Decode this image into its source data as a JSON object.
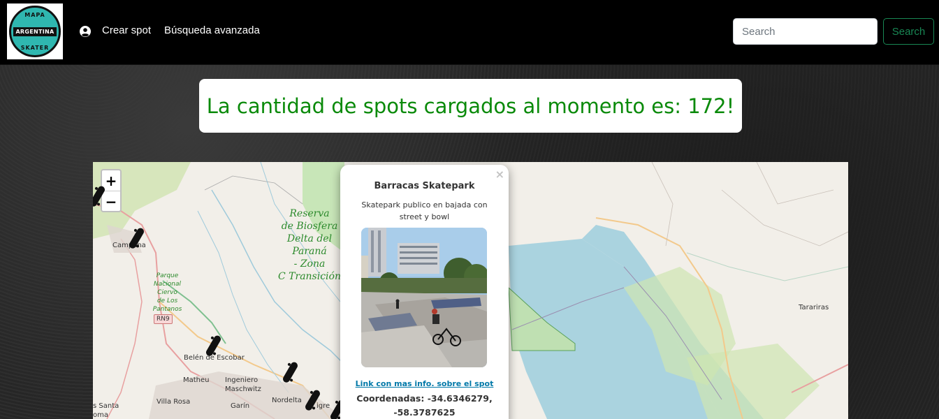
{
  "navbar": {
    "logo": {
      "top_text": "MAPA",
      "band_text": "ARGENTINA",
      "bottom_text": "SKATER"
    },
    "user_icon": "user-circle-icon",
    "links": [
      "Crear spot",
      "Búsqueda avanzada"
    ],
    "search": {
      "placeholder": "Search",
      "button_label": "Search",
      "button_color": "#198754"
    }
  },
  "banner": {
    "text": "La cantidad de spots cargados al momento es: 172!",
    "color": "#0a8a0a"
  },
  "map": {
    "zoom_in": "+",
    "zoom_out": "−",
    "reserve_lines": [
      "Reserva",
      "de Biosfera",
      "Delta del",
      "Paraná",
      "- Zona",
      "C Transición"
    ],
    "park_lines": [
      "Parque",
      "Nacional",
      "Ciervo",
      "de Los",
      "Pantanos"
    ],
    "road_badge": "RN9",
    "labels": {
      "campana": "Campana",
      "belen": "Belén de Escobar",
      "matheu": "Matheu",
      "ingeniero": "Ingeniero",
      "maschwitz": "Maschwitz",
      "nordelta": "Nordelta",
      "villa_rosa": "Villa Rosa",
      "garin": "Garín",
      "santa": "s Santa",
      "roma": "oma",
      "tigre": "igre",
      "tarariras": "Tarariras"
    },
    "marker_icon": "skateboard-icon"
  },
  "popup": {
    "close": "×",
    "title": "Barracas Skatepark",
    "description": "Skatepark publico en bajada con street y bowl",
    "link": "Link con mas info. sobre el spot",
    "coords_line1": "Coordenadas: -34.6346279,",
    "coords_line2": "-58.3787625"
  }
}
